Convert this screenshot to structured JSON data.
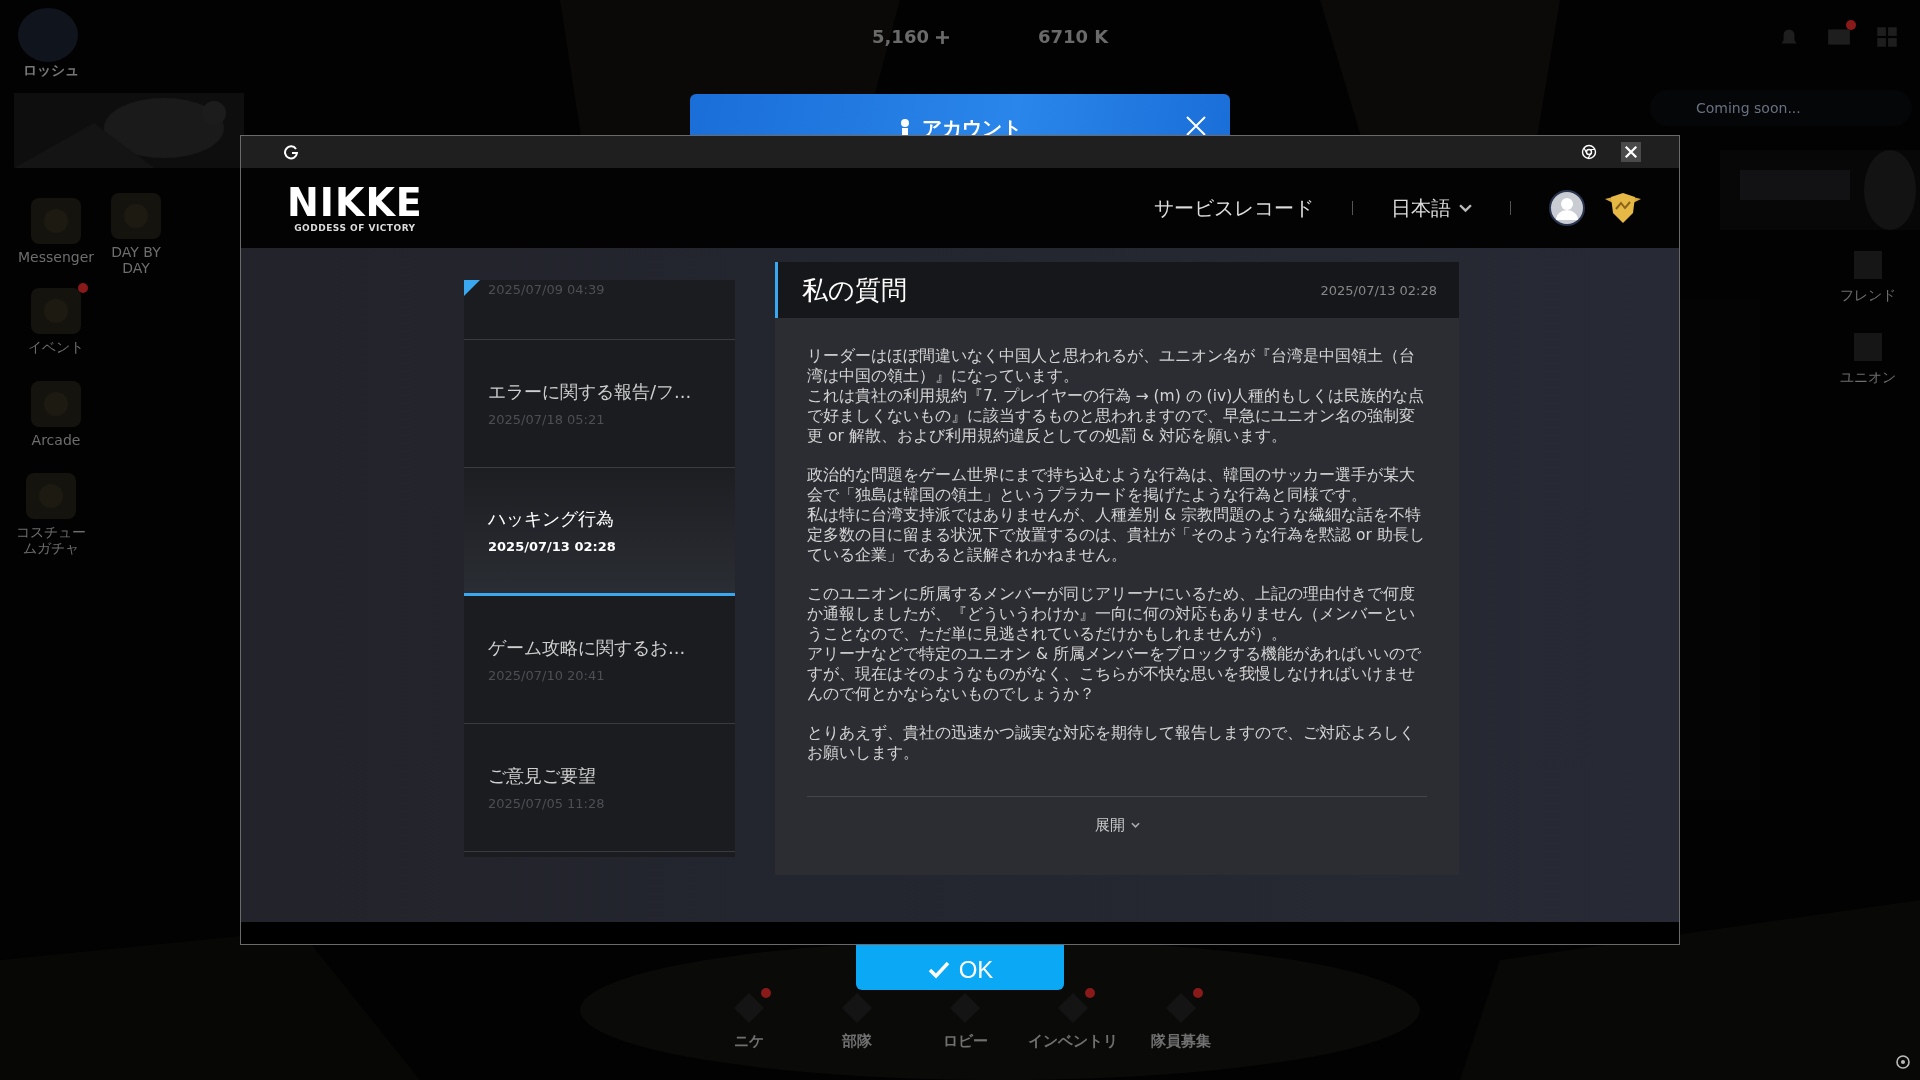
{
  "game_hud": {
    "player_name": "ロッシュ",
    "currencies": [
      "5,160",
      "6710 K"
    ],
    "plus_button": true,
    "left_menu": [
      {
        "label": "Messenger",
        "notification": false
      },
      {
        "label": "DAY BY DAY",
        "notification": false
      },
      {
        "label": "イベント",
        "notification": true
      },
      {
        "label": "Arcade",
        "notification": false
      },
      {
        "label": "コスチュームガチャ",
        "notification": false
      }
    ],
    "mail_notification": true,
    "notice": "Coming soon...",
    "right_menu": [
      "フレンド",
      "ユニオン"
    ],
    "bottom_nav": [
      {
        "label": "ニケ",
        "notification": true
      },
      {
        "label": "部隊",
        "notification": false
      },
      {
        "label": "ロビー",
        "notification": false
      },
      {
        "label": "インベントリ",
        "notification": true
      },
      {
        "label": "隊員募集",
        "notification": true
      }
    ]
  },
  "account_dialog": {
    "title": "アカウント",
    "ok_button": "OK"
  },
  "browser": {
    "logo": "NIKKE",
    "logo_tagline": "GODDESS OF VICTORY",
    "nav_link": "サービスレコード",
    "language": "日本語",
    "tickets": [
      {
        "date": "2025/07/09 04:39",
        "selected": false
      },
      {
        "title": "エラーに関する報告/フ...",
        "date": "2025/07/18 05:21",
        "selected": false
      },
      {
        "title": "ハッキング行為",
        "date": "2025/07/13 02:28",
        "selected": true
      },
      {
        "title": "ゲーム攻略に関するお...",
        "date": "2025/07/10 20:41",
        "selected": false
      },
      {
        "title": "ご意見ご要望",
        "date": "2025/07/05 11:28",
        "selected": false
      }
    ],
    "detail": {
      "title": "私の質問",
      "date": "2025/07/13 02:28",
      "paragraphs": [
        [
          "リーダーはほぼ間違いなく中国人と思われるが、ユニオン名が『台湾是中国領土（台湾は中国の領土）』になっています。",
          "これは貴社の利用規約『7. プレイヤーの行為 → (m) の (iv)人種的もしくは民族的な点で好ましくないもの』に該当するものと思われますので、早急にユニオン名の強制変更 or 解散、および利用規約違反としての処罰 & 対応を願います。"
        ],
        [
          "政治的な問題をゲーム世界にまで持ち込むような行為は、韓国のサッカー選手が某大会で「独島は韓国の領土」というプラカードを掲げたような行為と同様です。",
          "私は特に台湾支持派ではありませんが、人種差別 & 宗教問題のような繊細な話を不特定多数の目に留まる状況下で放置するのは、貴社が「そのような行為を黙認 or 助長している企業」であると誤解されかねません。"
        ],
        [
          "このユニオンに所属するメンバーが同じアリーナにいるため、上記の理由付きで何度か通報しましたが、『どういうわけか』一向に何の対応もありません（メンバーということなので、ただ単に見逃されているだけかもしれませんが）。",
          "アリーナなどで特定のユニオン & 所属メンバーをブロックする機能があればいいのですが、現在はそのようなものがなく、こちらが不快な思いを我慢しなければいけませんので何とかならないものでしょうか？"
        ],
        [
          "とりあえず、貴社の迅速かつ誠実な対応を期待して報告しますので、ご対応よろしくお願いします。"
        ]
      ],
      "expand": "展開"
    }
  }
}
